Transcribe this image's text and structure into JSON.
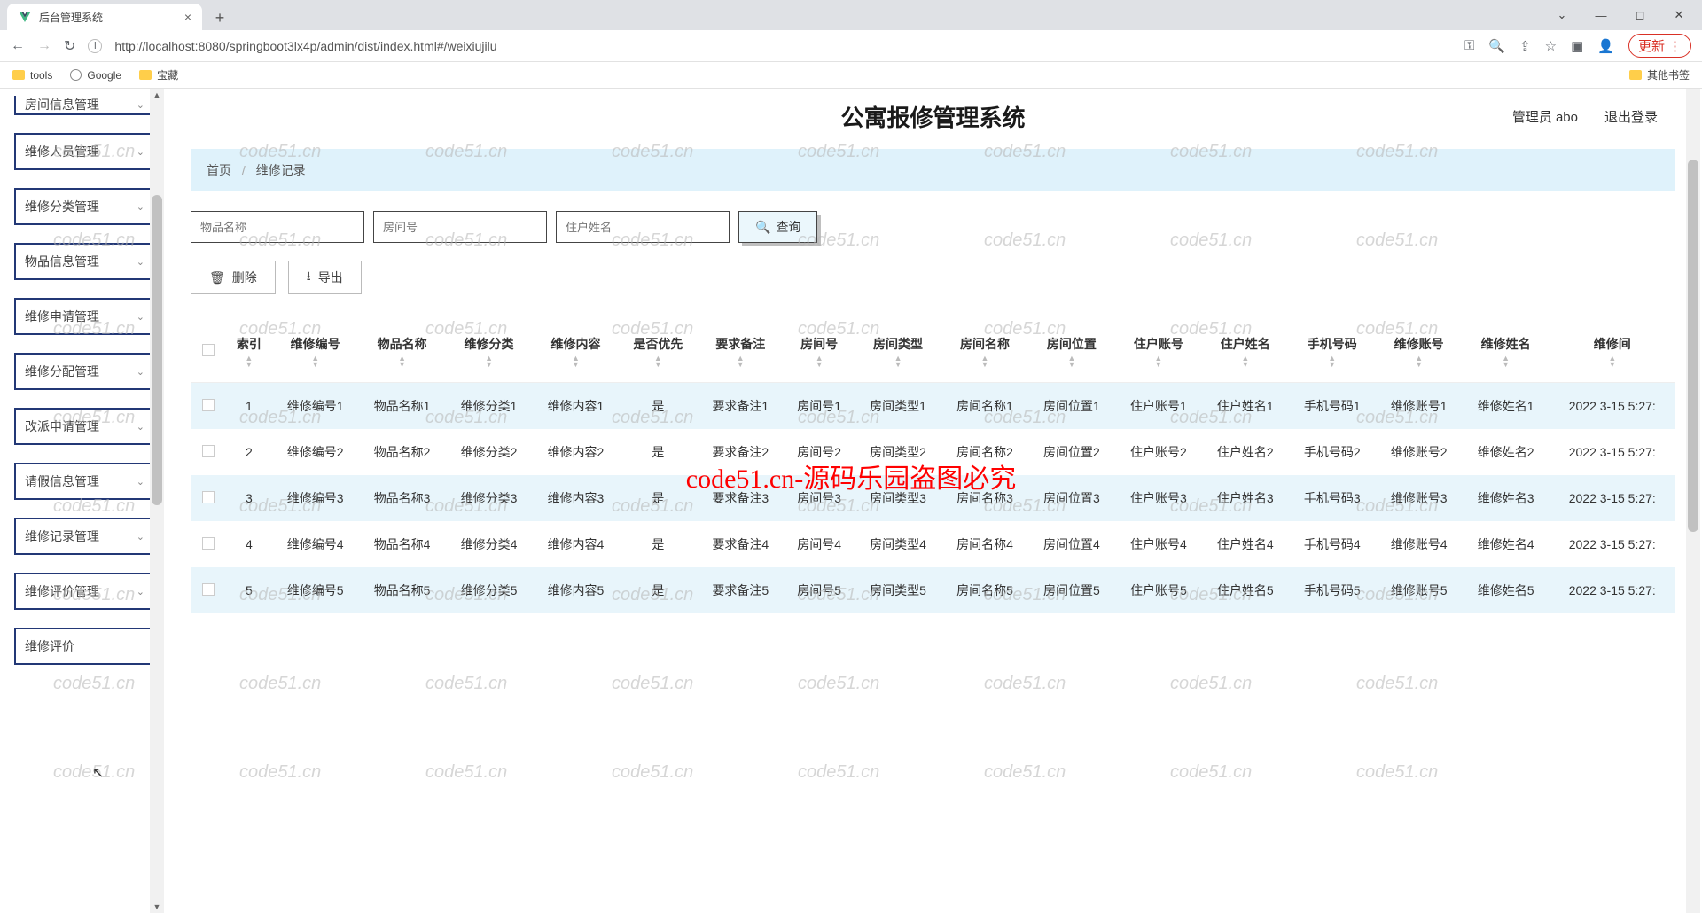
{
  "browser": {
    "tab_title": "后台管理系统",
    "url": "http://localhost:8080/springboot3lx4p/admin/dist/index.html#/weixiujilu",
    "update_label": "更新",
    "bookmarks": [
      "tools",
      "Google",
      "宝藏"
    ],
    "other_bookmarks": "其他书签"
  },
  "header": {
    "app_title": "公寓报修管理系统",
    "user_label": "管理员 abo",
    "logout": "退出登录"
  },
  "breadcrumb": {
    "home": "首页",
    "current": "维修记录"
  },
  "sidebar": {
    "items": [
      "房间信息管理",
      "维修人员管理",
      "维修分类管理",
      "物品信息管理",
      "维修申请管理",
      "维修分配管理",
      "改派申请管理",
      "请假信息管理",
      "维修记录管理",
      "维修评价管理",
      "维修评价"
    ]
  },
  "search": {
    "ph1": "物品名称",
    "ph2": "房间号",
    "ph3": "住户姓名",
    "btn": "查询"
  },
  "actions": {
    "delete": "删除",
    "export": "导出"
  },
  "table": {
    "headers": [
      "",
      "索引",
      "维修编号",
      "物品名称",
      "维修分类",
      "维修内容",
      "是否优先",
      "要求备注",
      "房间号",
      "房间类型",
      "房间名称",
      "房间位置",
      "住户账号",
      "住户姓名",
      "手机号码",
      "维修账号",
      "维修姓名",
      "维修间"
    ],
    "rows": [
      {
        "idx": "1",
        "rid": "维修编号1",
        "item": "物品名称1",
        "cat": "维修分类1",
        "cont": "维修内容1",
        "pri": "是",
        "note": "要求备注1",
        "room": "房间号1",
        "rtype": "房间类型1",
        "rname": "房间名称1",
        "rloc": "房间位置1",
        "uacct": "住户账号1",
        "uname": "住户姓名1",
        "phone": "手机号码1",
        "macct": "维修账号1",
        "mname": "维修姓名1",
        "time": "2022 3-15 5:27:"
      },
      {
        "idx": "2",
        "rid": "维修编号2",
        "item": "物品名称2",
        "cat": "维修分类2",
        "cont": "维修内容2",
        "pri": "是",
        "note": "要求备注2",
        "room": "房间号2",
        "rtype": "房间类型2",
        "rname": "房间名称2",
        "rloc": "房间位置2",
        "uacct": "住户账号2",
        "uname": "住户姓名2",
        "phone": "手机号码2",
        "macct": "维修账号2",
        "mname": "维修姓名2",
        "time": "2022 3-15 5:27:"
      },
      {
        "idx": "3",
        "rid": "维修编号3",
        "item": "物品名称3",
        "cat": "维修分类3",
        "cont": "维修内容3",
        "pri": "是",
        "note": "要求备注3",
        "room": "房间号3",
        "rtype": "房间类型3",
        "rname": "房间名称3",
        "rloc": "房间位置3",
        "uacct": "住户账号3",
        "uname": "住户姓名3",
        "phone": "手机号码3",
        "macct": "维修账号3",
        "mname": "维修姓名3",
        "time": "2022 3-15 5:27:"
      },
      {
        "idx": "4",
        "rid": "维修编号4",
        "item": "物品名称4",
        "cat": "维修分类4",
        "cont": "维修内容4",
        "pri": "是",
        "note": "要求备注4",
        "room": "房间号4",
        "rtype": "房间类型4",
        "rname": "房间名称4",
        "rloc": "房间位置4",
        "uacct": "住户账号4",
        "uname": "住户姓名4",
        "phone": "手机号码4",
        "macct": "维修账号4",
        "mname": "维修姓名4",
        "time": "2022 3-15 5:27:"
      },
      {
        "idx": "5",
        "rid": "维修编号5",
        "item": "物品名称5",
        "cat": "维修分类5",
        "cont": "维修内容5",
        "pri": "是",
        "note": "要求备注5",
        "room": "房间号5",
        "rtype": "房间类型5",
        "rname": "房间名称5",
        "rloc": "房间位置5",
        "uacct": "住户账号5",
        "uname": "住户姓名5",
        "phone": "手机号码5",
        "macct": "维修账号5",
        "mname": "维修姓名5",
        "time": "2022 3-15 5:27:"
      }
    ]
  },
  "watermark_text": "code51.cn",
  "red_overlay": "code51.cn-源码乐园盗图必究"
}
